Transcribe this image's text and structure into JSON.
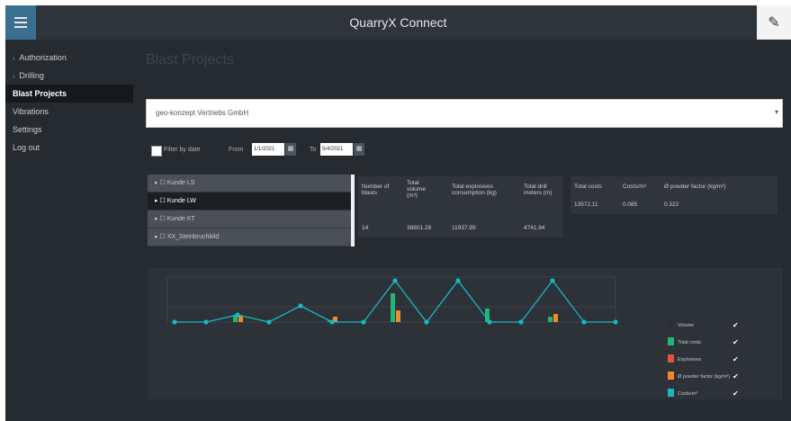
{
  "app": {
    "title": "QuarryX Connect"
  },
  "sidebar": {
    "items": [
      {
        "label": "Authorization",
        "caret": "›"
      },
      {
        "label": "Drilling",
        "caret": "›"
      },
      {
        "label": "Blast Projects",
        "active": true
      },
      {
        "label": "Vibrations"
      },
      {
        "label": "Settings"
      },
      {
        "label": "Log out"
      }
    ]
  },
  "page": {
    "heading": "Blast Projects"
  },
  "company_select": {
    "value": "geo-konzept Vertriebs GmbH"
  },
  "filter": {
    "label": "Filter by date",
    "from_label": "From",
    "from_value": "1/1/2021",
    "to_label": "To",
    "to_value": "5/4/2021"
  },
  "projects": [
    {
      "label": "Kunde LS"
    },
    {
      "label": "Kunde LW",
      "selected": true
    },
    {
      "label": "Kunde KT"
    },
    {
      "label": "XX_Steinbruchbild"
    }
  ],
  "stats_table": {
    "headers": [
      "Number of blasts",
      "Total volume (m³)",
      "Total explosives consumption (kg)",
      "Total drill meters (m)"
    ],
    "values": [
      "14",
      "38801.28",
      "11937.99",
      "4741.94"
    ]
  },
  "stats_table2": {
    "headers": [
      "Total costs",
      "Costs/m³",
      "Ø powder factor (kg/m³)"
    ],
    "values": [
      "13572.11",
      "0.085",
      "0.322"
    ]
  },
  "chart_data": {
    "type": "line",
    "x_tick_labels": [
      "",
      "",
      "",
      "",
      "",
      "",
      "",
      "",
      "",
      "",
      "",
      "",
      "",
      "",
      ""
    ],
    "series": [
      {
        "name": "Volume",
        "color": "#2b2f33",
        "values": []
      },
      {
        "name": "Total costs",
        "color": "#22b573",
        "values": [
          0,
          0,
          0.4,
          0,
          0,
          0.1,
          0,
          1.6,
          0,
          0,
          0.75,
          0,
          0.3,
          0,
          0
        ]
      },
      {
        "name": "Explosives",
        "color": "#e0553a",
        "values": [
          0,
          0,
          0.3,
          0,
          0,
          0,
          0,
          0,
          0,
          0,
          0,
          0,
          0,
          0,
          0
        ]
      },
      {
        "name": "Ø powder factor (kg/m³)",
        "color": "#f08a24",
        "values": [
          0,
          0,
          0.35,
          0,
          0,
          0.3,
          0,
          0.65,
          0,
          0,
          0,
          0,
          0.45,
          0,
          0
        ]
      },
      {
        "name": "Costs/m³",
        "color": "#19b7c4",
        "values": [
          0,
          0,
          0.4,
          0,
          0.9,
          0,
          0,
          2.3,
          0,
          2.3,
          0,
          0,
          2.3,
          0,
          0
        ]
      }
    ],
    "y_ticks": [
      "",
      "",
      ""
    ],
    "legend_placement": "bottom-right",
    "grid": true
  }
}
